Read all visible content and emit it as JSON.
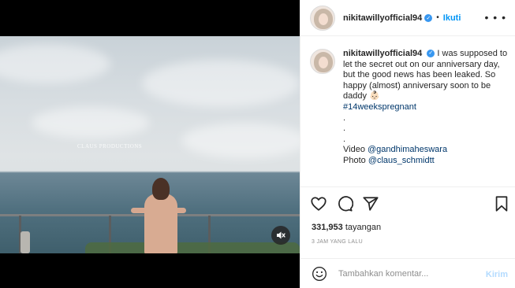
{
  "post": {
    "username": "nikitawillyofficial94",
    "follow_label": "Ikuti",
    "separator": "•",
    "more_label": "• • •",
    "video_watermark": "CLAUS PRODUCTIONS"
  },
  "caption": {
    "username": "nikitawillyofficial94",
    "text": "I was supposed to let the secret out on our anniversary day, but the good news has been leaked. So happy (almost) anniversary soon to be daddy 👶🏻",
    "hashtag": "#14weekspregnant",
    "dots": [
      ".",
      ".",
      "."
    ],
    "credit_video_label": "Video ",
    "credit_video_handle": "@gandhimaheswara",
    "credit_photo_label": "Photo ",
    "credit_photo_handle": "@claus_schmidtt"
  },
  "stats": {
    "views_count": "331,953",
    "views_label": "tayangan",
    "time_ago": "3 JAM YANG LALU"
  },
  "comment": {
    "placeholder": "Tambahkan komentar...",
    "send_label": "Kirim"
  },
  "colors": {
    "accent": "#0095f6",
    "verified": "#3897f0",
    "send_disabled": "#b3dbff",
    "muted_text": "#8e8e8e"
  }
}
